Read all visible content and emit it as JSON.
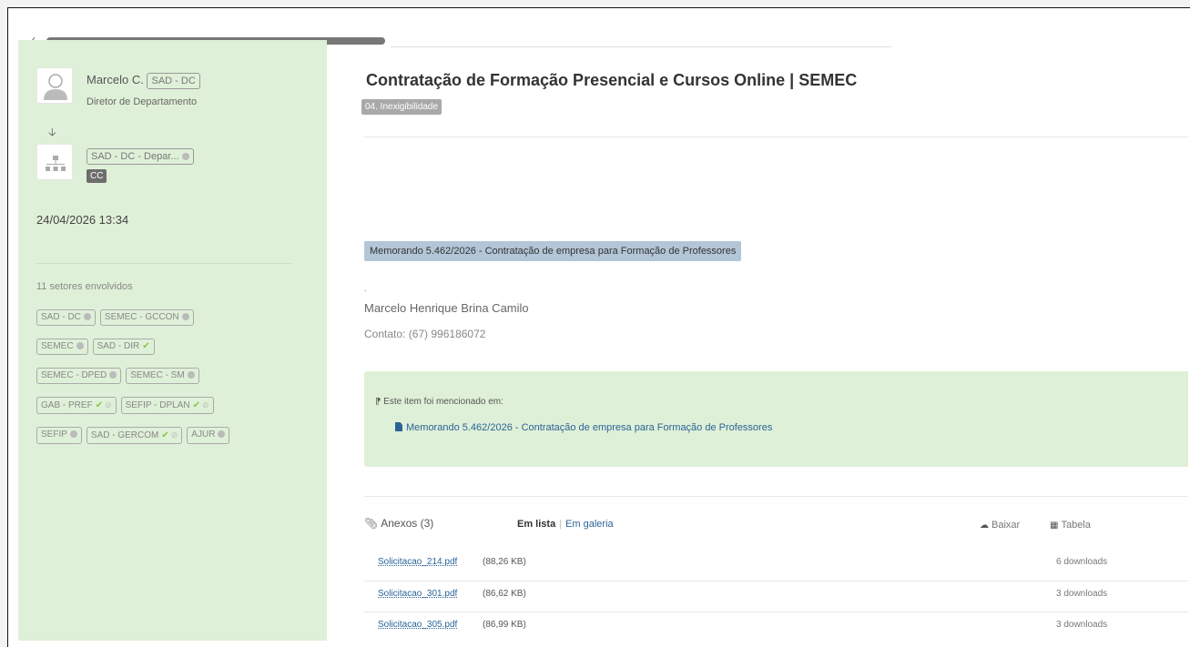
{
  "user": {
    "name": "Marcelo C.",
    "sector_tag": "SAD - DC",
    "role": "Diretor de Departamento"
  },
  "dept": {
    "tag": "SAD - DC - Depar...",
    "badge": "CC"
  },
  "date": "24/04/2026 13:34",
  "sectors": {
    "title": "11 setores envolvidos",
    "rows": [
      [
        "SAD - DC",
        "SEMEC - GCCON"
      ],
      [
        "SEMEC",
        "SAD - DIR"
      ],
      [
        "SEMEC - DPED",
        "SEMEC - SM"
      ],
      [
        "GAB - PREF",
        "SEFIP - DPLAN"
      ],
      [
        "SEFIP",
        "SAD - GERCOM",
        "AJUR"
      ]
    ]
  },
  "doc": {
    "title": "Contratação de Formação Presencial e Cursos Online | SEMEC",
    "category": "04. Inexigibilidade",
    "memo_label": "Memorando 5.462/2026 - Contratação de empresa para Formação de Professores",
    "signer": "Marcelo Henrique Brina Camilo",
    "contact": "Contato: (67) 996186072"
  },
  "mention": {
    "title": "Este item foi mencionado em:",
    "link": "Memorando 5.462/2026 - Contratação de empresa para Formação de Professores"
  },
  "attachments": {
    "label": "Anexos (3)",
    "view_list": "Em lista",
    "view_gallery": "Em galeria",
    "download_label": "Baixar",
    "table_label": "Tabela",
    "files": [
      {
        "name": "Solicitacao_214.pdf",
        "size": "(88,26 KB)",
        "downloads": "6 downloads"
      },
      {
        "name": "Solicitacao_301.pdf",
        "size": "(86,62 KB)",
        "downloads": "3 downloads"
      },
      {
        "name": "Solicitacao_305.pdf",
        "size": "(86,99 KB)",
        "downloads": "3 downloads"
      }
    ]
  }
}
